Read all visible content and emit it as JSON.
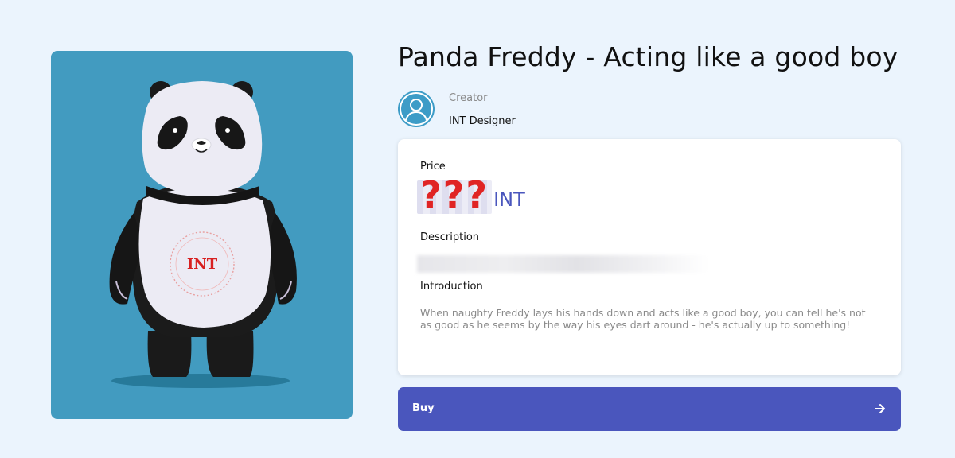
{
  "product": {
    "title": "Panda Freddy - Acting like a good boy",
    "artwork_logo_text": "INT"
  },
  "creator": {
    "label": "Creator",
    "name": "INT Designer"
  },
  "info": {
    "price_label": "Price",
    "price_value": "???",
    "price_currency": "INT",
    "description_label": "Description",
    "introduction_label": "Introduction",
    "introduction_text": "When naughty Freddy lays his hands down and acts like a good boy, you can tell he's not as good as he seems by the way his eyes dart around - he's actually up to something!"
  },
  "buy": {
    "label": "Buy"
  },
  "colors": {
    "page_background": "#ebf4fd",
    "art_background": "#429bc0",
    "accent": "#4a56bd",
    "price_highlight": "#e02424"
  },
  "icons": {
    "avatar": "user-avatar-icon",
    "buy": "arrow-right-icon"
  }
}
